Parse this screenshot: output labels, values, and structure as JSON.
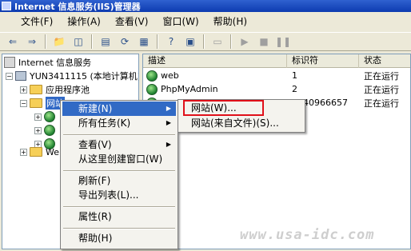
{
  "window": {
    "title": "Internet 信息服务(IIS)管理器"
  },
  "menubar": {
    "items": [
      "文件(F)",
      "操作(A)",
      "查看(V)",
      "窗口(W)",
      "帮助(H)"
    ]
  },
  "toolbar": {
    "buttons": [
      "back-icon",
      "forward-icon",
      "up-folder-icon",
      "show-tree-icon",
      "properties-icon",
      "refresh-icon",
      "export-icon",
      "help-icon",
      "console-icon",
      "computer-icon",
      "play-icon",
      "stop-icon",
      "pause-icon"
    ]
  },
  "tree": {
    "root": "Internet 信息服务",
    "computer": "YUN3411115 (本地计算机)",
    "app_pools": "应用程序池",
    "websites": "网站",
    "web_ext": "Web"
  },
  "list": {
    "columns": [
      "描述",
      "标识符",
      "状态"
    ],
    "rows": [
      {
        "name": "web",
        "id": "1",
        "status": "正在运行"
      },
      {
        "name": "PhpMyAdmin",
        "id": "2",
        "status": "正在运行"
      },
      {
        "name": "",
        "id": "1940966657",
        "status": "正在运行"
      }
    ]
  },
  "context_menu": {
    "new": "新建(N)",
    "all_tasks": "所有任务(K)",
    "view": "查看(V)",
    "new_window": "从这里创建窗口(W)",
    "refresh": "刷新(F)",
    "export": "导出列表(L)...",
    "properties": "属性(R)",
    "help": "帮助(H)"
  },
  "submenu": {
    "website": "网站(W)...",
    "website_from_file": "网站(来自文件)(S)..."
  },
  "watermark": "www.usa-idc.com",
  "colors": {
    "selection": "#316ac5",
    "highlight_box": "#e0101a"
  }
}
